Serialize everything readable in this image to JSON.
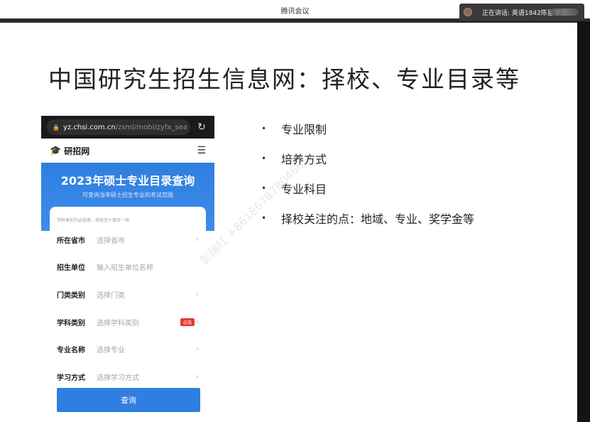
{
  "meeting": {
    "app_title": "腾讯会议",
    "speaking_label": "正在讲话: 英语1842陈星宇"
  },
  "slide": {
    "title": "中国研究生招生信息网：择校、专业目录等",
    "bullets": [
      "专业限制",
      "培养方式",
      "专业科目",
      "择校关注的点：地域、专业、奖学金等"
    ]
  },
  "phone": {
    "url_host": "yz.chsi.com.cn",
    "url_path": "/zsml/mobi/zyfx_sea",
    "site_name": "研招网",
    "hero_title": "2023年硕士专业目录查询",
    "hero_subtitle": "可查询当年硕士招生专业的考试范围",
    "form_hint": "学科类别为必选项，其他至少填写一项",
    "fields": [
      {
        "label": "所在省市",
        "placeholder": "选择省市",
        "chevron": "›"
      },
      {
        "label": "招生单位",
        "placeholder": "输入招生单位名称",
        "chevron": ""
      },
      {
        "label": "门类类别",
        "placeholder": "选择门类",
        "chevron": "›"
      },
      {
        "label": "学科类别",
        "placeholder": "选择学科类别",
        "chevron": "›",
        "required_tag": "必选"
      },
      {
        "label": "专业名称",
        "placeholder": "选择专业",
        "chevron": "›"
      },
      {
        "label": "学习方式",
        "placeholder": "选择学习方式",
        "chevron": "›"
      }
    ],
    "submit_label": "查询"
  },
  "watermark": "彭瑞红 +8618678780468",
  "colors": {
    "accent_blue": "#2f7fe0",
    "required_red": "#e53935"
  }
}
